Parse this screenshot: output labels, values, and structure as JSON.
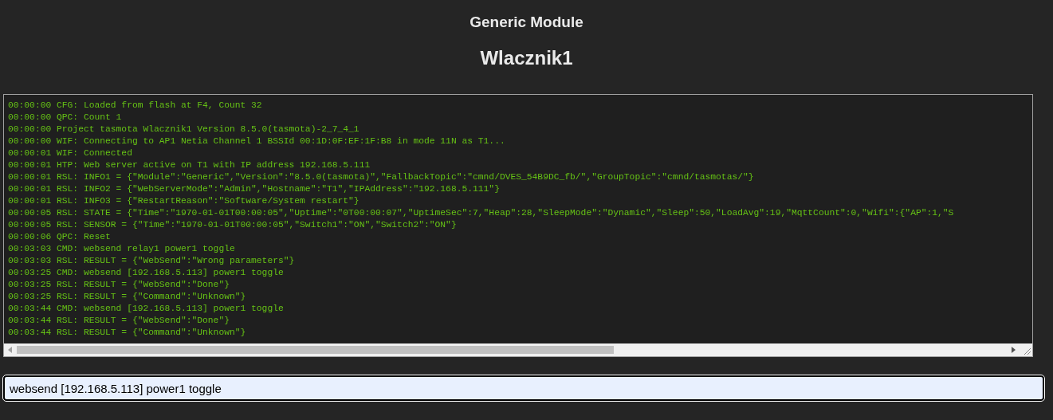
{
  "header": {
    "module": "Generic Module",
    "device": "Wlacznik1"
  },
  "console": {
    "lines": [
      "00:00:00 CFG: Loaded from flash at F4, Count 32",
      "00:00:00 QPC: Count 1",
      "00:00:00 Project tasmota Wlacznik1 Version 8.5.0(tasmota)-2_7_4_1",
      "00:00:00 WIF: Connecting to AP1 Netia Channel 1 BSSId 00:1D:0F:EF:1F:B8 in mode 11N as T1...",
      "00:00:01 WIF: Connected",
      "00:00:01 HTP: Web server active on T1 with IP address 192.168.5.111",
      "00:00:01 RSL: INFO1 = {\"Module\":\"Generic\",\"Version\":\"8.5.0(tasmota)\",\"FallbackTopic\":\"cmnd/DVES_54B9DC_fb/\",\"GroupTopic\":\"cmnd/tasmotas/\"}",
      "00:00:01 RSL: INFO2 = {\"WebServerMode\":\"Admin\",\"Hostname\":\"T1\",\"IPAddress\":\"192.168.5.111\"}",
      "00:00:01 RSL: INFO3 = {\"RestartReason\":\"Software/System restart\"}",
      "00:00:05 RSL: STATE = {\"Time\":\"1970-01-01T00:00:05\",\"Uptime\":\"0T00:00:07\",\"UptimeSec\":7,\"Heap\":28,\"SleepMode\":\"Dynamic\",\"Sleep\":50,\"LoadAvg\":19,\"MqttCount\":0,\"Wifi\":{\"AP\":1,\"S",
      "00:00:05 RSL: SENSOR = {\"Time\":\"1970-01-01T00:00:05\",\"Switch1\":\"ON\",\"Switch2\":\"ON\"}",
      "00:00:06 QPC: Reset",
      "00:03:03 CMD: websend relay1 power1 toggle",
      "00:03:03 RSL: RESULT = {\"WebSend\":\"Wrong parameters\"}",
      "00:03:25 CMD: websend [192.168.5.113] power1 toggle",
      "00:03:25 RSL: RESULT = {\"WebSend\":\"Done\"}",
      "00:03:25 RSL: RESULT = {\"Command\":\"Unknown\"}",
      "00:03:44 CMD: websend [192.168.5.113] power1 toggle",
      "00:03:44 RSL: RESULT = {\"WebSend\":\"Done\"}",
      "00:03:44 RSL: RESULT = {\"Command\":\"Unknown\"}"
    ]
  },
  "command": {
    "value": "websend [192.168.5.113] power1 toggle"
  }
}
